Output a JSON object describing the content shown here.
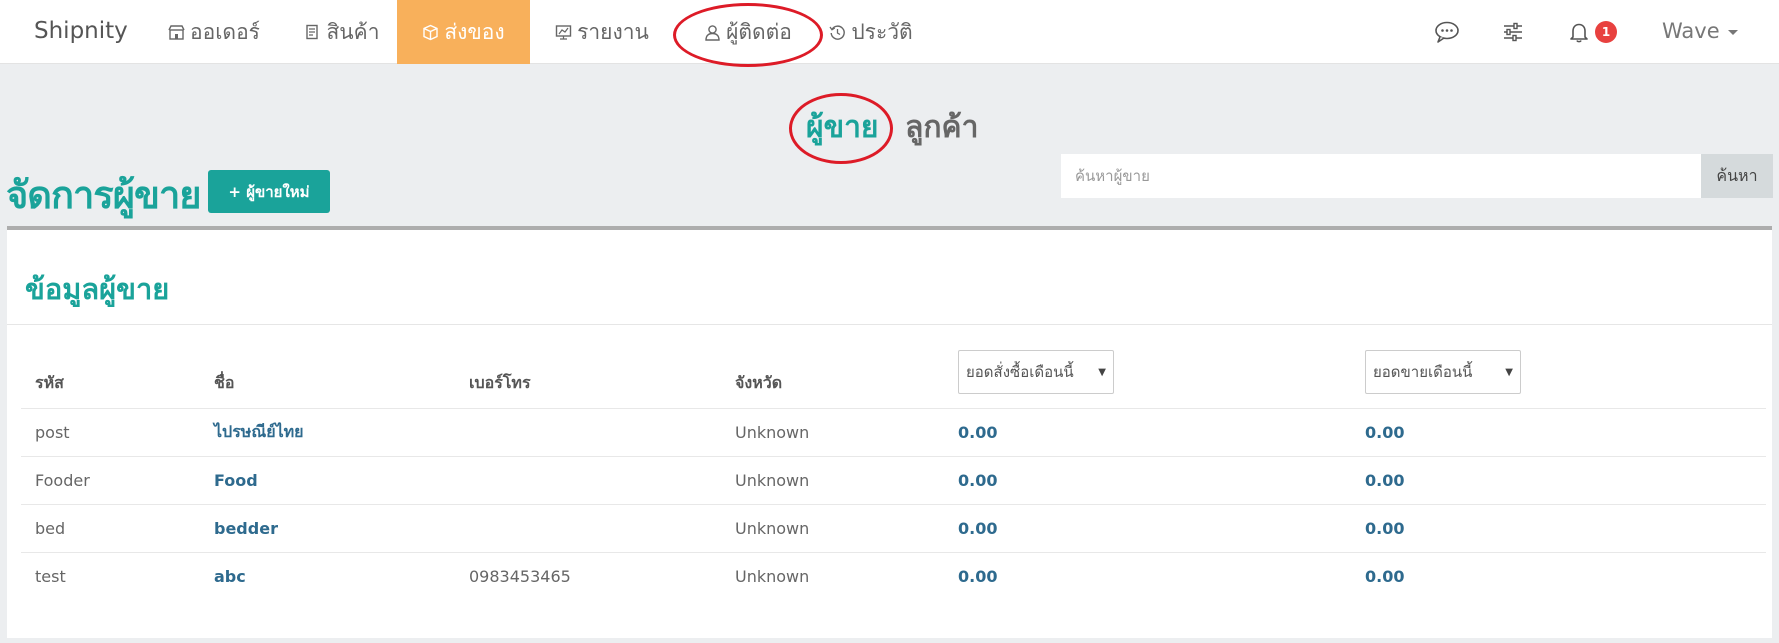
{
  "navbar": {
    "brand": "Shipnity",
    "items": [
      {
        "label": "ออเดอร์",
        "icon": "store-icon"
      },
      {
        "label": "สินค้า",
        "icon": "products-icon"
      },
      {
        "label": "ส่งของ",
        "icon": "box-icon",
        "active": true
      },
      {
        "label": "รายงาน",
        "icon": "report-icon"
      },
      {
        "label": "ผู้ติดต่อ",
        "icon": "user-icon"
      },
      {
        "label": "ประวัติ",
        "icon": "history-icon"
      }
    ],
    "right_icons": [
      "chat-icon",
      "settings-sliders-icon",
      "bell-icon"
    ],
    "notification_count": "1",
    "user_name": "Wave"
  },
  "contact_toggle": {
    "sellers": "ผู้ขาย",
    "customers": "ลูกค้า",
    "active": "sellers"
  },
  "page": {
    "title": "จัดการผู้ขาย",
    "new_button": "+ ผู้ขายใหม่",
    "search_placeholder": "ค้นหาผู้ขาย",
    "search_button": "ค้นหา"
  },
  "panel": {
    "title": "ข้อมูลผู้ขาย",
    "columns": {
      "code": "รหัส",
      "name": "ชื่อ",
      "phone": "เบอร์โทร",
      "province": "จังหวัด",
      "orders_filter": "ยอดสั่งซื้อเดือนนี้",
      "sales_filter": "ยอดขายเดือนนี้"
    },
    "rows": [
      {
        "code": "post",
        "name": "ไปรษณีย์ไทย",
        "phone": "",
        "province": "Unknown",
        "orders": "0.00",
        "sales": "0.00"
      },
      {
        "code": "Fooder",
        "name": "Food",
        "phone": "",
        "province": "Unknown",
        "orders": "0.00",
        "sales": "0.00"
      },
      {
        "code": "bed",
        "name": "bedder",
        "phone": "",
        "province": "Unknown",
        "orders": "0.00",
        "sales": "0.00"
      },
      {
        "code": "test",
        "name": "abc",
        "phone": "0983453465",
        "province": "Unknown",
        "orders": "0.00",
        "sales": "0.00"
      }
    ]
  },
  "colors": {
    "brand_teal": "#1aa39a",
    "active_nav": "#f8b05b",
    "link_blue": "#2e6a8e",
    "badge_red": "#e8413f",
    "annotation_red": "#dd1b27"
  }
}
